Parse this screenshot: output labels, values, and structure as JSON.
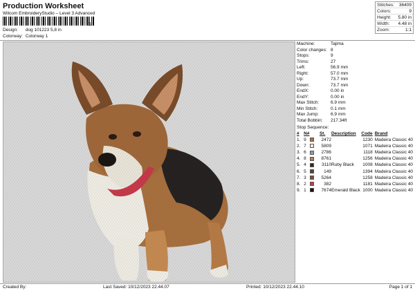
{
  "header": {
    "title": "Production Worksheet",
    "subtitle": "Wilcom EmbroideryStudio – Level 3 Advanced",
    "barcode_suffix": "1"
  },
  "design_info": {
    "design_label": "Design:",
    "design_value": "dog 101223 5,8 in",
    "colorway_label": "Colorway:",
    "colorway_value": "Colorway 1"
  },
  "stats": [
    {
      "label": "Stitches:",
      "value": "36409"
    },
    {
      "label": "Colors:",
      "value": "9"
    },
    {
      "label": "Height:",
      "value": "5.80 in"
    },
    {
      "label": "Width:",
      "value": "4.48 in"
    },
    {
      "label": "Zoom:",
      "value": "1:1"
    }
  ],
  "machine_info": [
    {
      "label": "Machine:",
      "value": "Tajima"
    },
    {
      "label": "Color changes:",
      "value": "8"
    },
    {
      "label": "Stops:",
      "value": "9"
    },
    {
      "label": "Trims:",
      "value": "27"
    },
    {
      "label": "Left:",
      "value": "56.9 mm"
    },
    {
      "label": "Right:",
      "value": "57.0 mm"
    },
    {
      "label": "Up:",
      "value": "73.7 mm"
    },
    {
      "label": "Down:",
      "value": "73.7 mm"
    },
    {
      "label": "EndX:",
      "value": "0.00 in"
    },
    {
      "label": "EndY:",
      "value": "0.00 in"
    },
    {
      "label": "Max Stitch:",
      "value": "6.9 mm"
    },
    {
      "label": "Min Stitch:",
      "value": "0.1 mm"
    },
    {
      "label": "Max Jump:",
      "value": "6.9 mm"
    },
    {
      "label": "Total Bobbin:",
      "value": "217.34ft"
    }
  ],
  "sequence": {
    "title": "Stop Sequence:",
    "headers": [
      "#",
      "N#",
      "St.",
      "Description",
      "Code",
      "Brand"
    ],
    "rows": [
      {
        "num": "1.",
        "n": "9",
        "color": "#a8744a",
        "st": "2472",
        "desc": "",
        "code": "1230",
        "brand": "Madeira Classic 40"
      },
      {
        "num": "2.",
        "n": "7",
        "color": "#ece8dc",
        "st": "5809",
        "desc": "",
        "code": "1071",
        "brand": "Madeira Classic 40"
      },
      {
        "num": "3.",
        "n": "6",
        "color": "#8e9ea4",
        "st": "2786",
        "desc": "",
        "code": "1118",
        "brand": "Madeira Classic 40"
      },
      {
        "num": "4.",
        "n": "8",
        "color": "#b87a4a",
        "st": "8761",
        "desc": "",
        "code": "1256",
        "brand": "Madeira Classic 40"
      },
      {
        "num": "5.",
        "n": "4",
        "color": "#2a2a2a",
        "st": "3110",
        "desc": "Ruby Black",
        "code": "1008",
        "brand": "Madeira Classic 40"
      },
      {
        "num": "6.",
        "n": "5",
        "color": "#5a4032",
        "st": "149",
        "desc": "",
        "code": "1394",
        "brand": "Madeira Classic 40"
      },
      {
        "num": "7.",
        "n": "3",
        "color": "#7a5236",
        "st": "5264",
        "desc": "",
        "code": "1258",
        "brand": "Madeira Classic 40"
      },
      {
        "num": "8.",
        "n": "2",
        "color": "#c63a4a",
        "st": "382",
        "desc": "",
        "code": "1181",
        "brand": "Madeira Classic 40"
      },
      {
        "num": "9.",
        "n": "1",
        "color": "#111111",
        "st": "7674",
        "desc": "Emerald Black",
        "code": "1000",
        "brand": "Madeira Classic 40"
      }
    ]
  },
  "footer": {
    "created_by": "Created By:",
    "last_saved": "Last Saved: 10/12/2023 22.44.07",
    "printed": "Printed: 10/12/2023 22.44.10",
    "page": "Page 1 of 1"
  }
}
